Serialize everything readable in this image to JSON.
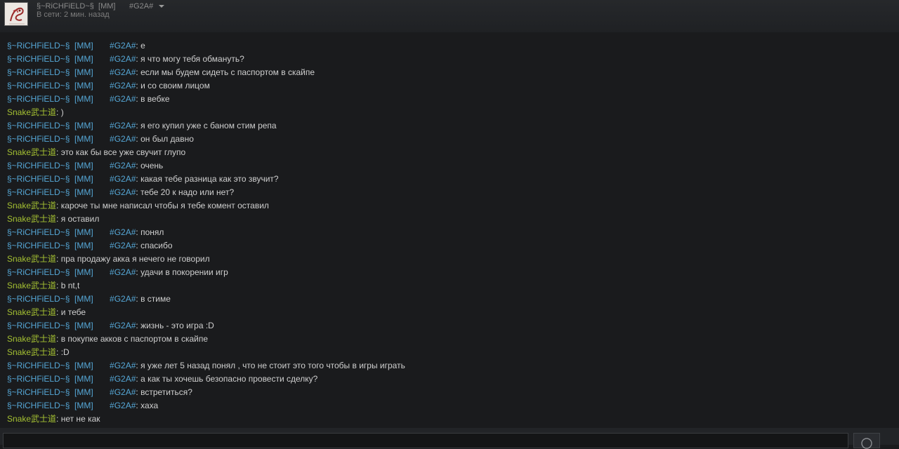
{
  "header": {
    "friend_name": "§~RiCHFiELD~§  [MM]",
    "status": "В сети: 2 мин. назад",
    "name_tag": "#G2A#"
  },
  "messages": [
    {
      "author": "§~RiCHFiELD~§  [MM]       #G2A#",
      "text": "е",
      "who": "r"
    },
    {
      "author": "§~RiCHFiELD~§  [MM]       #G2A#",
      "text": "я что могу тебя обмануть?",
      "who": "r"
    },
    {
      "author": "§~RiCHFiELD~§  [MM]       #G2A#",
      "text": "если мы будем сидеть с паспортом в скайпе",
      "who": "r"
    },
    {
      "author": "§~RiCHFiELD~§  [MM]       #G2A#",
      "text": "и со своим лицом",
      "who": "r"
    },
    {
      "author": "§~RiCHFiELD~§  [MM]       #G2A#",
      "text": "в вебке",
      "who": "r"
    },
    {
      "author": "Snake武士道",
      "text": ")",
      "who": "s"
    },
    {
      "author": "§~RiCHFiELD~§  [MM]       #G2A#",
      "text": "я его купил уже с баном стим репа",
      "who": "r"
    },
    {
      "author": "§~RiCHFiELD~§  [MM]       #G2A#",
      "text": "он был давно",
      "who": "r"
    },
    {
      "author": "Snake武士道",
      "text": "это как бы все уже свучит глупо",
      "who": "s"
    },
    {
      "author": "§~RiCHFiELD~§  [MM]       #G2A#",
      "text": "очень",
      "who": "r"
    },
    {
      "author": "§~RiCHFiELD~§  [MM]       #G2A#",
      "text": "какая тебе разница как это звучит?",
      "who": "r"
    },
    {
      "author": "§~RiCHFiELD~§  [MM]       #G2A#",
      "text": "тебе 20 к надо или нет?",
      "who": "r"
    },
    {
      "author": "Snake武士道",
      "text": "кароче ты мне написал чтобы я тебе комент оставил",
      "who": "s"
    },
    {
      "author": "Snake武士道",
      "text": "я оставил",
      "who": "s"
    },
    {
      "author": "§~RiCHFiELD~§  [MM]       #G2A#",
      "text": "понял",
      "who": "r"
    },
    {
      "author": "§~RiCHFiELD~§  [MM]       #G2A#",
      "text": "спасибо",
      "who": "r"
    },
    {
      "author": "Snake武士道",
      "text": "пра продажу акка я нечего не говорил",
      "who": "s"
    },
    {
      "author": "§~RiCHFiELD~§  [MM]       #G2A#",
      "text": "удачи в покорении игр",
      "who": "r"
    },
    {
      "author": "Snake武士道",
      "text": "b nt,t",
      "who": "s"
    },
    {
      "author": "§~RiCHFiELD~§  [MM]       #G2A#",
      "text": "в стиме",
      "who": "r"
    },
    {
      "author": "Snake武士道",
      "text": "и тебе",
      "who": "s"
    },
    {
      "author": "§~RiCHFiELD~§  [MM]       #G2A#",
      "text": "жизнь - это игра :D",
      "who": "r"
    },
    {
      "author": "Snake武士道",
      "text": "в покупке акков с паспортом в скайпе",
      "who": "s"
    },
    {
      "author": "Snake武士道",
      "text": ":D",
      "who": "s"
    },
    {
      "author": "§~RiCHFiELD~§  [MM]       #G2A#",
      "text": "я уже лет 5 назад понял , что не стоит это того чтобы в игры играть",
      "who": "r"
    },
    {
      "author": "§~RiCHFiELD~§  [MM]       #G2A#",
      "text": "а как ты хочешь безопасно провести сделку?",
      "who": "r"
    },
    {
      "author": "§~RiCHFiELD~§  [MM]       #G2A#",
      "text": "встретиться?",
      "who": "r"
    },
    {
      "author": "§~RiCHFiELD~§  [MM]       #G2A#",
      "text": "хаха",
      "who": "r"
    },
    {
      "author": "Snake武士道",
      "text": "нет не как",
      "who": "s"
    },
    {
      "author": "§~RiCHFiELD~§  [MM]       #G2A#",
      "text": "",
      "who": "r"
    }
  ],
  "colors": {
    "friend": "#55a7d6",
    "self": "#a4c032",
    "text": "#cfcfcf"
  },
  "icons": {
    "dropdown": "chevron-down-icon",
    "emoticon": "smiley-icon"
  }
}
